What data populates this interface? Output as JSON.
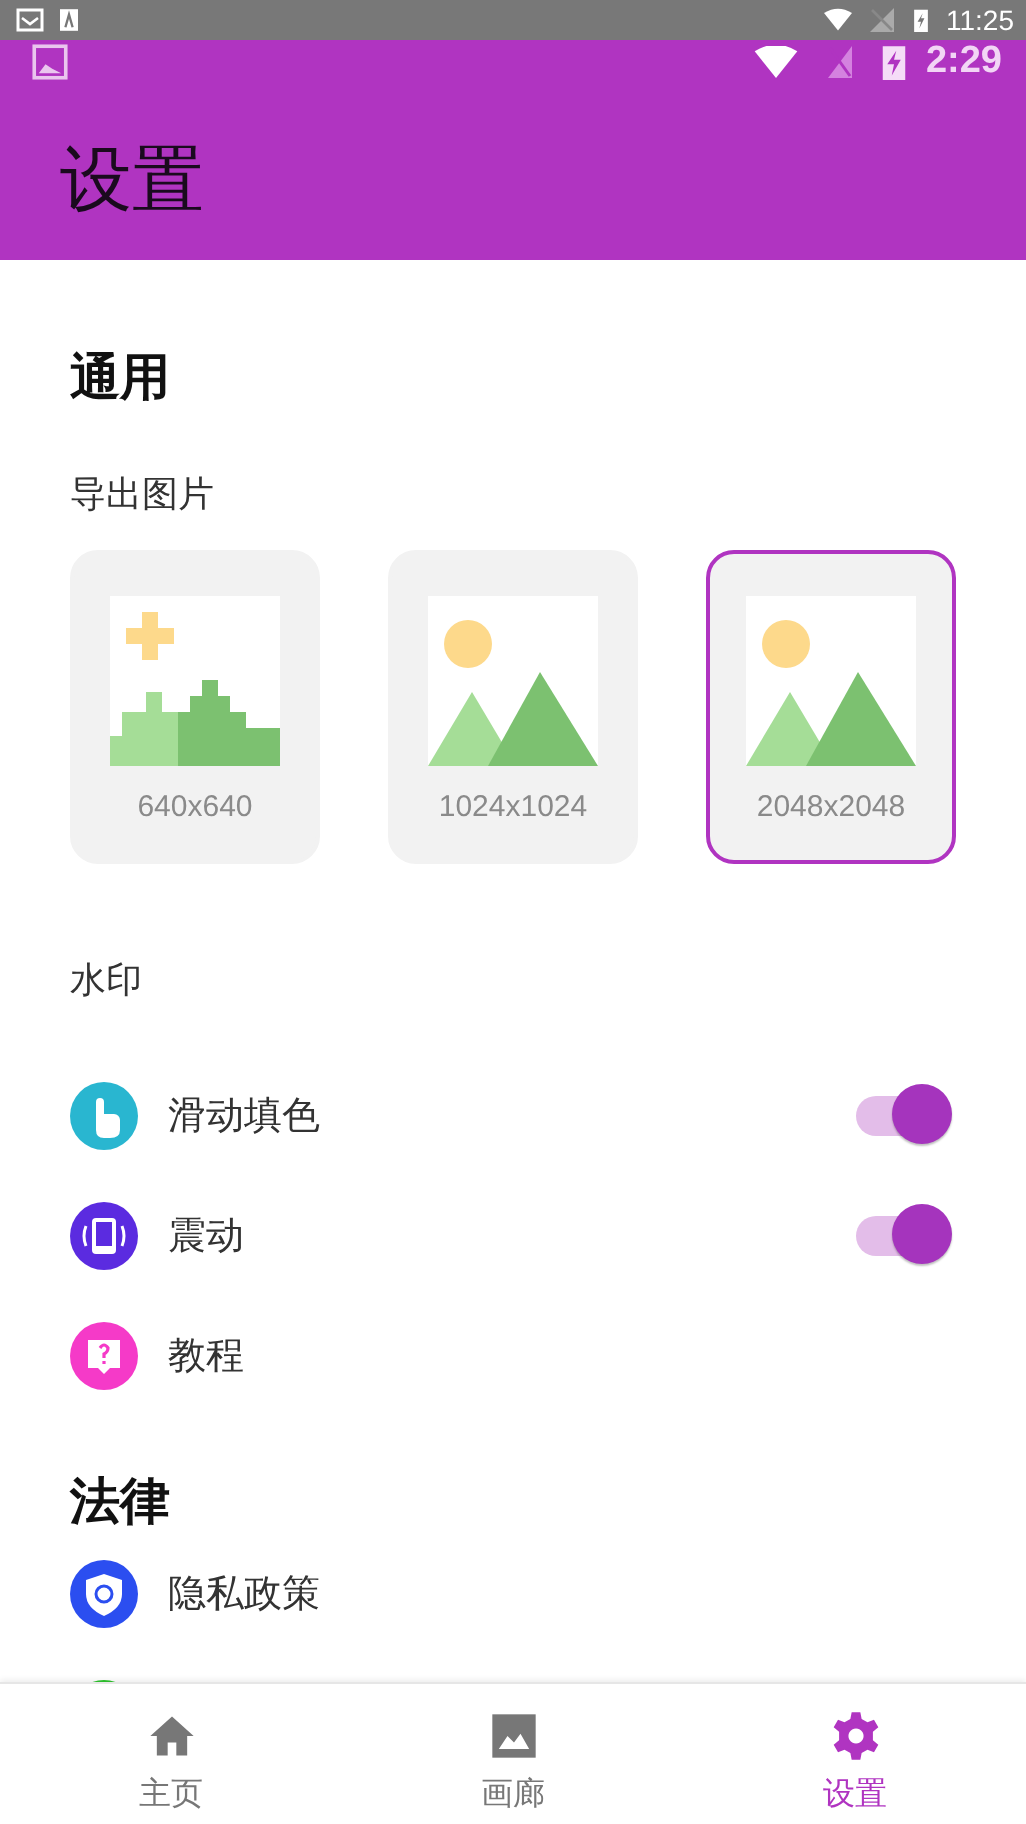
{
  "system_status": {
    "time": "11:25"
  },
  "app_status": {
    "time": "2:29"
  },
  "title": "设置",
  "general": {
    "heading": "通用",
    "export_label": "导出图片",
    "export_options": [
      {
        "label": "640x640",
        "selected": false
      },
      {
        "label": "1024x1024",
        "selected": false
      },
      {
        "label": "2048x2048",
        "selected": true
      }
    ],
    "watermark_label": "水印",
    "items": [
      {
        "kind": "toggle",
        "label": "滑动填色",
        "color": "#29b6d0",
        "on": true
      },
      {
        "kind": "toggle",
        "label": "震动",
        "color": "#5b2be0",
        "on": true
      },
      {
        "kind": "link",
        "label": "教程",
        "color": "#f53ac8"
      }
    ]
  },
  "legal": {
    "heading": "法律",
    "items": [
      {
        "label": "隐私政策",
        "color": "#2b4ef0"
      },
      {
        "color": "#2ec52e"
      }
    ]
  },
  "nav": [
    {
      "label": "主页",
      "selected": false
    },
    {
      "label": "画廊",
      "selected": false
    },
    {
      "label": "设置",
      "selected": true
    }
  ]
}
